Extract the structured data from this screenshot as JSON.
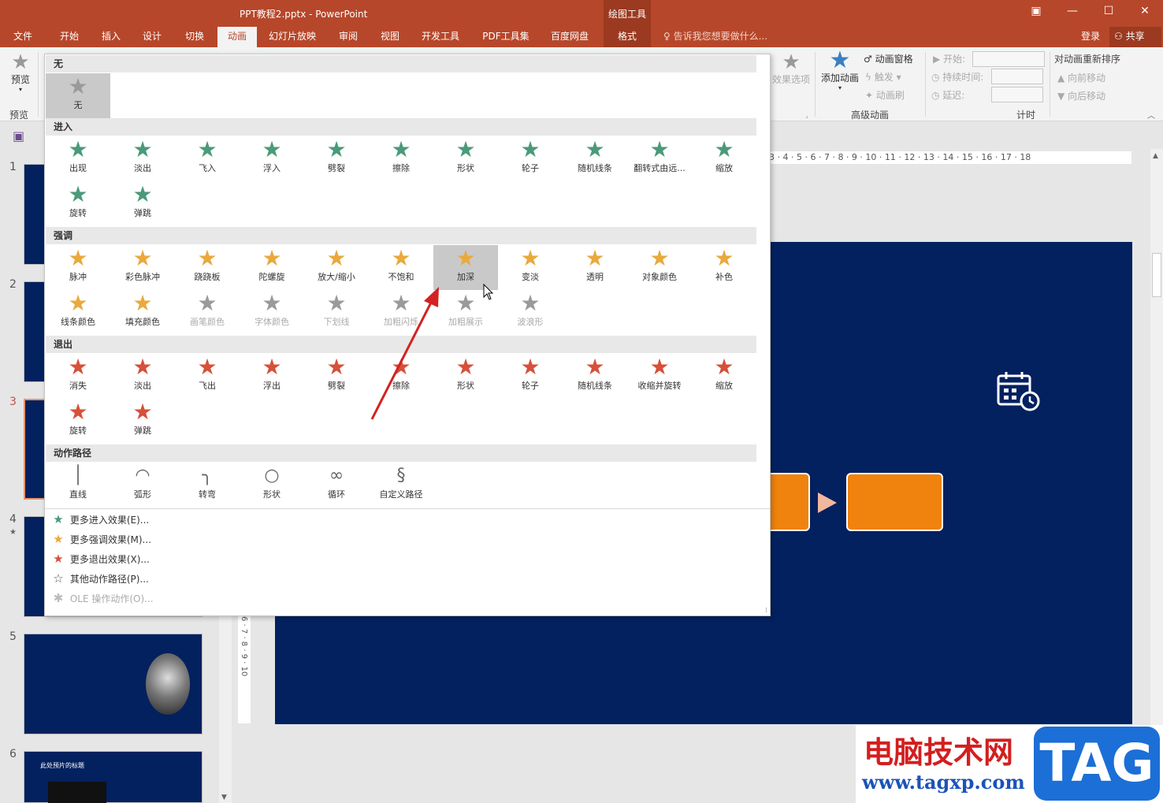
{
  "window": {
    "title": "PPT教程2.pptx - PowerPoint",
    "context_group": "绘图工具"
  },
  "tabs": [
    {
      "label": "文件"
    },
    {
      "label": "开始"
    },
    {
      "label": "插入"
    },
    {
      "label": "设计"
    },
    {
      "label": "切换"
    },
    {
      "label": "动画"
    },
    {
      "label": "幻灯片放映"
    },
    {
      "label": "审阅"
    },
    {
      "label": "视图"
    },
    {
      "label": "开发工具"
    },
    {
      "label": "PDF工具集"
    },
    {
      "label": "百度网盘"
    },
    {
      "label": "格式"
    }
  ],
  "tell_me": "告诉我您想要做什么...",
  "account": {
    "login": "登录",
    "share": "共享"
  },
  "ribbon": {
    "preview": "预览",
    "preview_group": "预览",
    "effect_options": "效果选项",
    "add_animation": "添加动画",
    "animation_pane": "动画窗格",
    "trigger": "触发",
    "animation_painter": "动画刷",
    "advanced_group": "高级动画",
    "start_label": "开始:",
    "duration_label": "持续时间:",
    "delay_label": "延迟:",
    "timing_group": "计时",
    "reorder_title": "对动画重新排序",
    "move_earlier": "向前移动",
    "move_later": "向后移动"
  },
  "gallery": {
    "sections": {
      "none": "无",
      "entrance": "进入",
      "emphasis": "强调",
      "exit": "退出",
      "motion": "动作路径"
    },
    "none_items": [
      "无"
    ],
    "entrance_items": [
      "出现",
      "淡出",
      "飞入",
      "浮入",
      "劈裂",
      "擦除",
      "形状",
      "轮子",
      "随机线条",
      "翻转式由远...",
      "缩放",
      "旋转",
      "弹跳"
    ],
    "emphasis_items": [
      "脉冲",
      "彩色脉冲",
      "跷跷板",
      "陀螺旋",
      "放大/缩小",
      "不饱和",
      "加深",
      "变淡",
      "透明",
      "对象颜色",
      "补色",
      "线条颜色",
      "填充颜色",
      "画笔颜色",
      "字体颜色",
      "下划线",
      "加粗闪烁",
      "加粗展示",
      "波浪形"
    ],
    "exit_items": [
      "消失",
      "淡出",
      "飞出",
      "浮出",
      "劈裂",
      "擦除",
      "形状",
      "轮子",
      "随机线条",
      "收缩并旋转",
      "缩放",
      "旋转",
      "弹跳"
    ],
    "motion_items": [
      "直线",
      "弧形",
      "转弯",
      "形状",
      "循环",
      "自定义路径"
    ],
    "menu": [
      "更多进入效果(E)...",
      "更多强调效果(M)...",
      "更多退出效果(X)...",
      "其他动作路径(P)...",
      "OLE 操作动作(O)..."
    ]
  },
  "slides": {
    "numbers": [
      "1",
      "2",
      "3",
      "4",
      "5",
      "6"
    ],
    "slide6_title": "此处预片的标题"
  },
  "ruler_h": "3 · 4 · 5 · 6 · 7 · 8 · 9 · 10 · 11 · 12 · 13 · 14 · 15 · 16 · 17 · 18",
  "ruler_v": "6 · 7 · 8 · 9 · 10",
  "watermark": {
    "cn": "电脑技术网",
    "url": "www.tagxp.com",
    "tag": "TAG"
  },
  "colors": {
    "accent": "#b7472a",
    "slide_bg": "#03215f",
    "box": "#f0830d",
    "entrance": "#4a9a7a",
    "emphasis": "#e9a93d",
    "exit": "#d6503a"
  }
}
